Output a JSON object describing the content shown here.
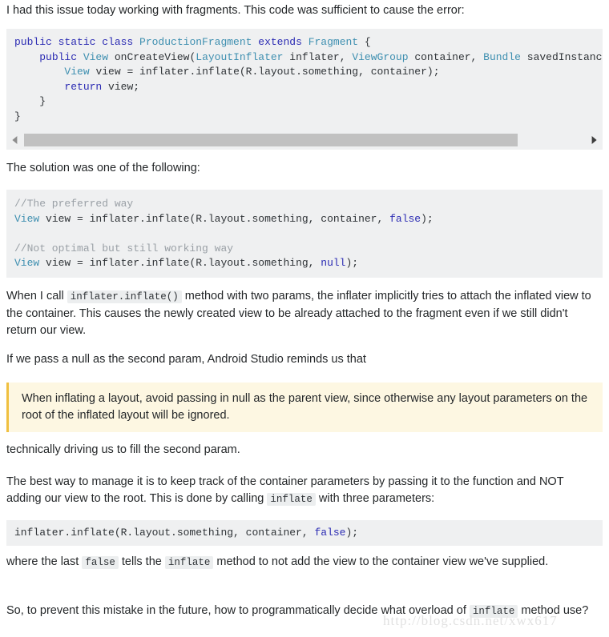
{
  "paragraphs": {
    "intro": "I had this issue today working with fragments. This code was sufficient to cause the error:",
    "solution_lead": "The solution was one of the following:",
    "when_call_1": "When I call ",
    "when_call_code": "inflater.inflate()",
    "when_call_2": " method with two params, the inflater implicitly tries to attach the inflated view to the container. This causes the newly created view to be already attached to the fragment even if we still didn't return our view.",
    "if_pass_null": "If we pass a null as the second param, Android Studio reminds us that",
    "technically": "technically driving us to fill the second param.",
    "best_way_1": "The best way to manage it is to keep track of the container parameters by passing it to the function and NOT adding our view to the root. This is done by calling ",
    "best_way_code": "inflate",
    "best_way_2": " with three parameters:",
    "where_last_1": "where the last ",
    "where_last_code_false": "false",
    "where_last_2": " tells the ",
    "where_last_code_inflate": "inflate",
    "where_last_3": " method to not add the view to the container view we've supplied.",
    "so_prevent_1": "So, to prevent this mistake in the future, how to programmatically decide what overload of ",
    "so_prevent_code": "inflate",
    "so_prevent_2": " method use?"
  },
  "note": {
    "text": "When inflating a layout, avoid passing in null as the parent view, since otherwise any layout parameters on the root of the inflated layout will be ignored.",
    "background": "#fdf7e2",
    "border_color": "#f0c040"
  },
  "code_block_1": {
    "background": "#eff0f1",
    "lines": [
      [
        {
          "t": "public static class ",
          "c": "kw"
        },
        {
          "t": "ProductionFragment",
          "c": "typ"
        },
        {
          "t": " extends ",
          "c": "kw"
        },
        {
          "t": "Fragment",
          "c": "typ"
        },
        {
          "t": " {",
          "c": "pln"
        }
      ],
      [
        {
          "t": "    ",
          "c": "pln"
        },
        {
          "t": "public ",
          "c": "kw"
        },
        {
          "t": "View",
          "c": "typ"
        },
        {
          "t": " onCreateView(",
          "c": "pln"
        },
        {
          "t": "LayoutInflater",
          "c": "typ"
        },
        {
          "t": " inflater, ",
          "c": "pln"
        },
        {
          "t": "ViewGroup",
          "c": "typ"
        },
        {
          "t": " container, ",
          "c": "pln"
        },
        {
          "t": "Bundle",
          "c": "typ"
        },
        {
          "t": " savedInstanceState) {",
          "c": "pln"
        }
      ],
      [
        {
          "t": "        ",
          "c": "pln"
        },
        {
          "t": "View",
          "c": "typ"
        },
        {
          "t": " view = inflater.inflate(R.layout.something, container);",
          "c": "pln"
        }
      ],
      [
        {
          "t": "        ",
          "c": "pln"
        },
        {
          "t": "return",
          "c": "kw"
        },
        {
          "t": " view;",
          "c": "pln"
        }
      ],
      [
        {
          "t": "    }",
          "c": "pln"
        }
      ],
      [
        {
          "t": "}",
          "c": "pln"
        }
      ]
    ]
  },
  "code_block_2": {
    "background": "#eff0f1",
    "lines": [
      [
        {
          "t": "//The preferred way",
          "c": "cmt"
        }
      ],
      [
        {
          "t": "View",
          "c": "typ"
        },
        {
          "t": " view = inflater.inflate(R.layout.something, container, ",
          "c": "pln"
        },
        {
          "t": "false",
          "c": "kw"
        },
        {
          "t": ");",
          "c": "pln"
        }
      ],
      [
        {
          "t": "",
          "c": "pln"
        }
      ],
      [
        {
          "t": "//Not optimal but still working way",
          "c": "cmt"
        }
      ],
      [
        {
          "t": "View",
          "c": "typ"
        },
        {
          "t": " view = inflater.inflate(R.layout.something, ",
          "c": "pln"
        },
        {
          "t": "null",
          "c": "kw"
        },
        {
          "t": ");",
          "c": "pln"
        }
      ]
    ]
  },
  "code_block_3": {
    "background": "#eff0f1",
    "lines": [
      [
        {
          "t": "inflater.inflate(R.layout.something, container, ",
          "c": "pln"
        },
        {
          "t": "false",
          "c": "kw"
        },
        {
          "t": ");",
          "c": "pln"
        }
      ]
    ]
  },
  "scrollbar": {
    "left_arrow": "◀",
    "right_arrow": "▶",
    "thumb_width_percent": 88,
    "thumb_color": "#c1c1c1",
    "track_color": "#eff0f1"
  },
  "watermark": {
    "text": "http://blog.csdn.net/xwx617",
    "color": "#e2e2e2"
  }
}
